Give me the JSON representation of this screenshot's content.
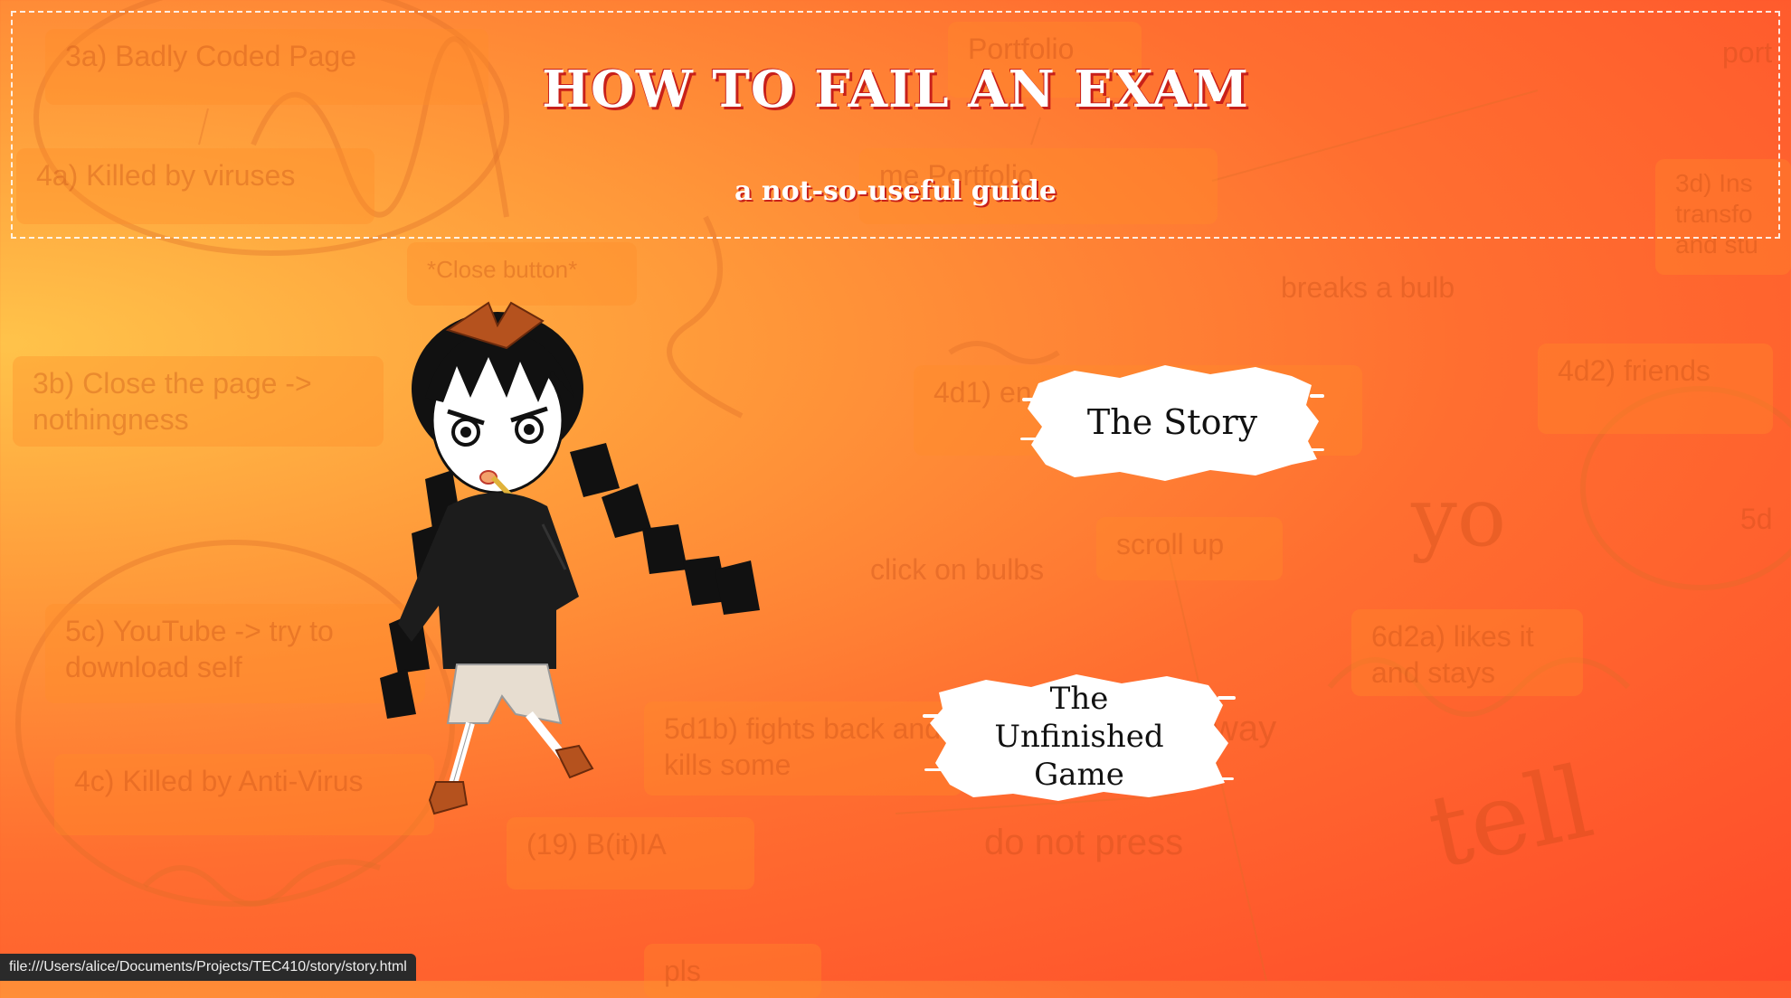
{
  "header": {
    "title": "HOW TO FAIL AN EXAM",
    "subtitle": "a not-so-useful guide"
  },
  "menu": {
    "story_label": "The Story",
    "game_label": "The Unfinished Game"
  },
  "background_boxes": [
    "3a)  Badly Coded Page",
    "4a)  Killed by viruses",
    "*Close button*",
    "3b)  Close the page -> nothingness",
    "5c)  YouTube -> try to download self",
    "4c)  Killed by Anti-Virus",
    "(19)  B(it)IA",
    "5d1b)  fights back and kills some",
    "4d1)  en him",
    "scroll up",
    "click on bulbs",
    "breaks a bulb",
    "4d2)  friends",
    "6d2a)  likes it and stays",
    "3d)  Ins transfo and stu",
    "Portfolio",
    "me Portfolio",
    "do not press",
    "allway",
    "pls",
    "port",
    "5d"
  ],
  "background_scribbles": [
    "yo",
    "tell"
  ],
  "status_bar": {
    "url": "file:///Users/alice/Documents/Projects/TEC410/story/story.html"
  },
  "colors": {
    "title_shadow": "#c8201a",
    "hair": "#111111",
    "bow": "#b5521e"
  }
}
